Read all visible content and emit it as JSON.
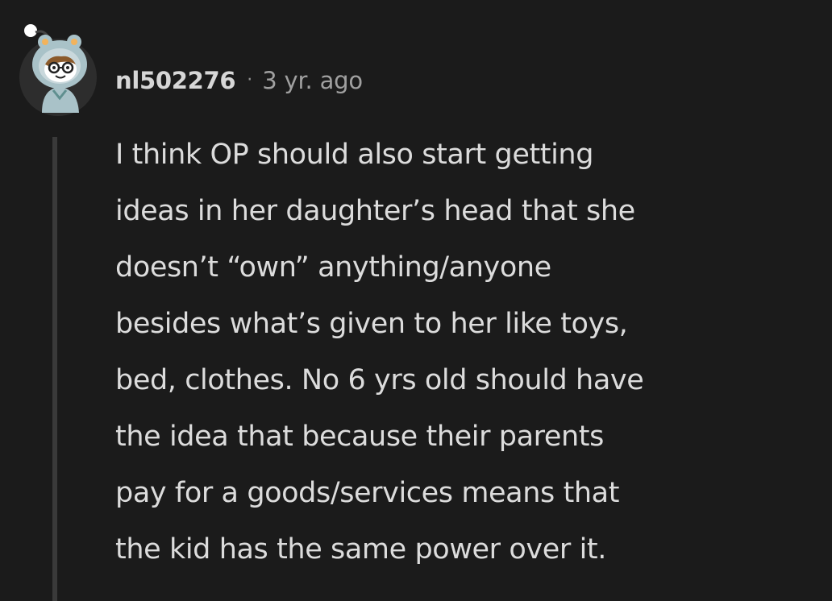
{
  "comment": {
    "username": "nl502276",
    "separator": "·",
    "timestamp": "3 yr. ago",
    "body_lines": [
      "I think OP should also start getting",
      "ideas in her daughter’s head that she",
      "doesn’t “own” anything/anyone",
      "besides what’s given to her like toys,",
      "bed, clothes. No 6 yrs old should have",
      "the idea that because their parents",
      "pay for a goods/services means that",
      "the kid has the same power over it."
    ]
  },
  "avatar": {
    "icon": "snoo-avatar-icon"
  },
  "colors": {
    "background": "#1b1b1b",
    "text": "#dcdcdc",
    "meta": "#a0a0a0",
    "thread_line": "#3a3a3a"
  }
}
